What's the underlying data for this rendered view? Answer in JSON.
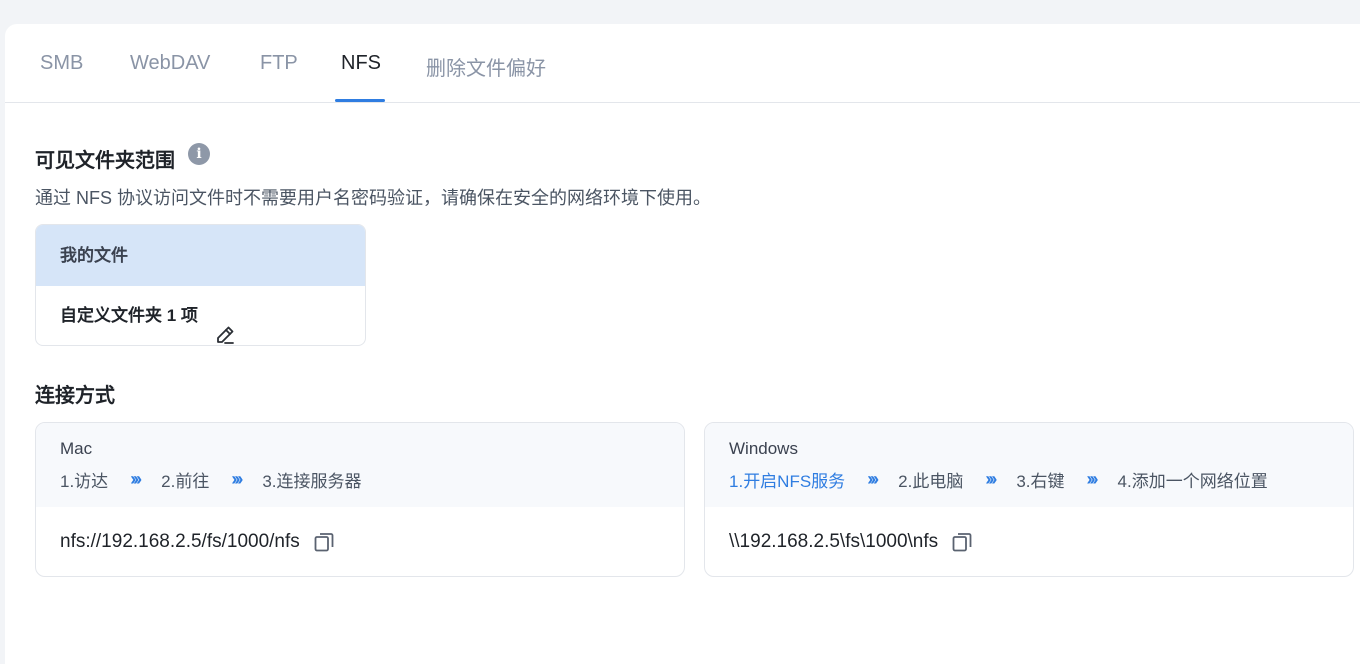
{
  "tabs": [
    {
      "label": "SMB"
    },
    {
      "label": "WebDAV"
    },
    {
      "label": "FTP"
    },
    {
      "label": "NFS"
    },
    {
      "label": "删除文件偏好"
    }
  ],
  "active_tab": "NFS",
  "visible_scope": {
    "title": "可见文件夹范围",
    "info_icon": "info-icon",
    "description": "通过 NFS 协议访问文件时不需要用户名密码验证，请确保在安全的网络环境下使用。",
    "folder_header": "我的文件",
    "folder_row": "自定义文件夹 1 项",
    "edit_icon": "pencil-icon"
  },
  "connection": {
    "title": "连接方式",
    "separator": "›››",
    "mac": {
      "name": "Mac",
      "steps": [
        "1.访达",
        "2.前往",
        "3.连接服务器"
      ],
      "path": "nfs://192.168.2.5/fs/1000/nfs"
    },
    "windows": {
      "name": "Windows",
      "step_prefix": "1.",
      "step_link": "开启NFS服务",
      "steps": [
        "2.此电脑",
        "3.右键",
        "4.添加一个网络位置"
      ],
      "path": "\\\\192.168.2.5\\fs\\1000\\nfs"
    }
  },
  "colors": {
    "accent": "#2f7de1",
    "folder_header_bg": "#d6e5f8",
    "page_bg": "#f2f4f7"
  }
}
